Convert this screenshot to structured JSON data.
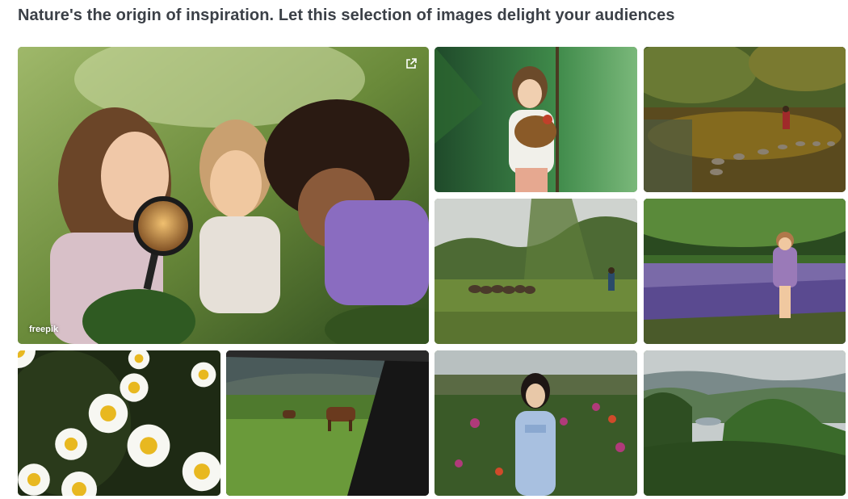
{
  "heading": "Nature's the origin of inspiration. Let this selection of images delight your audiences",
  "gallery": {
    "featured": {
      "badge": "freepik",
      "link_icon": "external-link-icon"
    },
    "images": [
      "children-magnifying-glass",
      "woman-holding-chicken",
      "person-crossing-stepping-stones",
      "shepherd-with-flock",
      "child-in-lavender-field",
      "white-daisies",
      "horses-through-car-window",
      "woman-in-dahlia-garden",
      "misty-green-mountains"
    ]
  },
  "colors": {
    "heading_text": "#3b4047",
    "background": "#ffffff",
    "badge_text": "#ffffff"
  }
}
